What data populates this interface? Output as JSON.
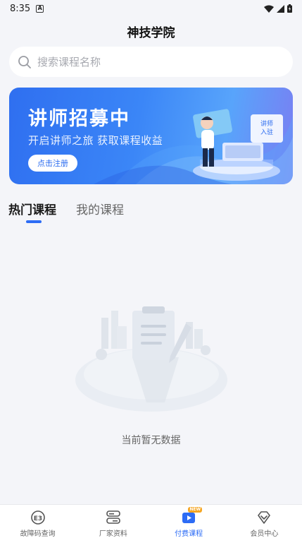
{
  "status_bar": {
    "time": "8:35",
    "notification_icon": "A"
  },
  "header": {
    "title": "神技学院"
  },
  "search": {
    "placeholder": "搜索课程名称"
  },
  "banner": {
    "title": "讲师招募中",
    "subtitle": "开启讲师之旅  获取课程收益",
    "button_label": "点击注册",
    "card_text_line1": "讲师",
    "card_text_line2": "入驻"
  },
  "tabs": [
    {
      "label": "热门课程",
      "active": true
    },
    {
      "label": "我的课程",
      "active": false
    }
  ],
  "empty_state": {
    "text": "当前暂无数据"
  },
  "bottom_nav": [
    {
      "label": "故障码查询",
      "icon": "e3-code-icon",
      "active": false
    },
    {
      "label": "厂家资料",
      "icon": "server-icon",
      "active": false
    },
    {
      "label": "付费课程",
      "icon": "video-course-icon",
      "active": true,
      "badge": "NEW"
    },
    {
      "label": "会员中心",
      "icon": "diamond-icon",
      "active": false
    }
  ],
  "colors": {
    "accent": "#2d6cf5",
    "background": "#f4f5f9"
  }
}
